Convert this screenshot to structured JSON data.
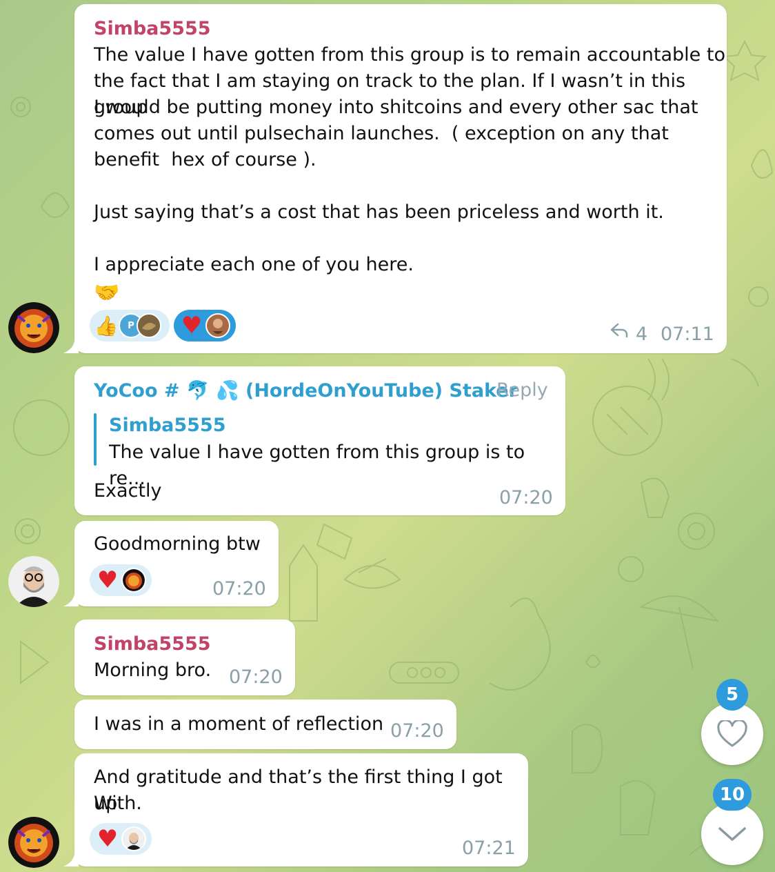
{
  "messages": {
    "m1": {
      "sender": "Simba5555",
      "lines": [
        "The value I have gotten from this group is to remain accountable to",
        "the fact that I am staying on track to the plan. If I wasn’t in this group",
        "I would be putting money into shitcoins and every other sac that",
        "comes out until pulsechain launches.  ( exception on any that",
        "benefit  hex of course ).",
        "",
        "Just saying that’s a cost that has been priceless and worth it.",
        "",
        "I appreciate each one of you here."
      ],
      "emoji": "🤝",
      "replies_count": "4",
      "time": "07:11"
    },
    "m2": {
      "sender": "YoCoo # 🐬 💦 (HordeOnYouTube) Staker",
      "reply_label": "Reply",
      "quote_sender": "Simba5555",
      "quote_text": "The value I have gotten from this group is to re...",
      "text": "Exactly",
      "time": "07:20"
    },
    "m3": {
      "text": "Goodmorning btw",
      "time": "07:20"
    },
    "m4": {
      "sender": "Simba5555",
      "text": "Morning bro.",
      "time": "07:20"
    },
    "m5": {
      "text": "I was in a moment of reflection",
      "time": "07:20"
    },
    "m6": {
      "line1": "And gratitude and that’s the first thing I got up",
      "line2": "With.",
      "time": "07:21"
    }
  },
  "reactions": {
    "thumbs": "👍",
    "heart": "♥",
    "p_avatar": "P"
  },
  "controls": {
    "reactions_badge": "5",
    "unread_badge": "10"
  },
  "colors": {
    "simba": "#c2436a",
    "yocoo": "#2f9fcf",
    "accent": "#2d9bdc"
  }
}
